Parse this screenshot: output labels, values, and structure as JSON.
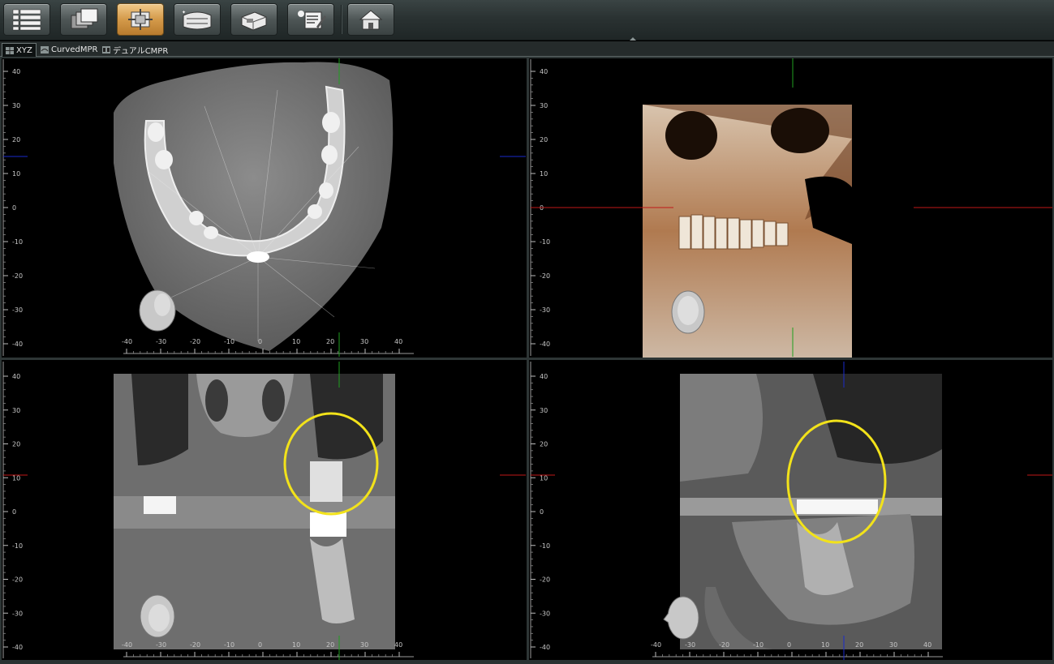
{
  "toolbar": {
    "buttons": [
      {
        "id": "list",
        "icon": "list-view-icon"
      },
      {
        "id": "layers",
        "icon": "layers-icon"
      },
      {
        "id": "mpr",
        "icon": "mpr-axes-icon",
        "active": true
      },
      {
        "id": "panorama",
        "icon": "panorama-arch-icon"
      },
      {
        "id": "volume",
        "icon": "volume-render-icon"
      },
      {
        "id": "report",
        "icon": "report-edit-icon"
      },
      {
        "id": "home",
        "icon": "home-icon"
      }
    ]
  },
  "tabs": [
    {
      "label": "XYZ",
      "active": true
    },
    {
      "label": "CurvedMPR",
      "active": false
    },
    {
      "label": "デュアルCMPR",
      "active": false
    }
  ],
  "rulers": {
    "vertical_labels": [
      "40",
      "30",
      "20",
      "10",
      "0",
      "-10",
      "-20",
      "-30",
      "-40"
    ],
    "horizontal_labels": [
      "-40",
      "-30",
      "-20",
      "-10",
      "0",
      "10",
      "20",
      "30",
      "40"
    ]
  },
  "viewports": [
    {
      "id": "axial",
      "label": "axial-slice-viewport"
    },
    {
      "id": "volume3d",
      "label": "volume-render-viewport"
    },
    {
      "id": "coronal",
      "label": "coronal-slice-viewport"
    },
    {
      "id": "sagittal",
      "label": "sagittal-slice-viewport"
    }
  ],
  "colors": {
    "crosshair_green": "#1fa01f",
    "crosshair_blue": "#1a2acc",
    "crosshair_red": "#c01818",
    "highlight_circle": "#f2e21a",
    "toolbar_active": "#d49a4a"
  }
}
